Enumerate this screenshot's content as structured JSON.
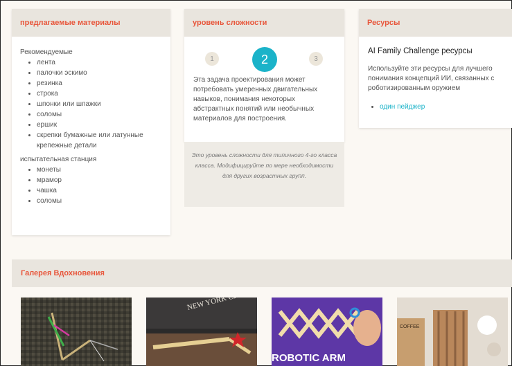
{
  "materials": {
    "title": "предлагаемые материалы",
    "recommended_label": "Рекомендуемые",
    "recommended": [
      "лента",
      "палочки эскимо",
      "резинка",
      "строка",
      "шпонки или шпажки",
      "соломы",
      "ершик",
      "скрепки бумажные или латунные крепежные детали"
    ],
    "station_label": "испытательная станция",
    "station": [
      "монеты",
      "мрамор",
      "чашка",
      "соломы"
    ]
  },
  "difficulty": {
    "title": "уровень сложности",
    "steps": [
      "1",
      "2",
      "3"
    ],
    "active_step": "2",
    "description": "Эта задача проектирования может потребовать умеренных двигательных навыков, понимания некоторых абстрактных понятий или необычных материалов для построения.",
    "note": "Это уровень сложности для типичного 4-го класса класса. Модифицируйте по мере необходимости для других возрастных групп."
  },
  "resources": {
    "title": "Ресурсы",
    "heading": "AI Family Challenge ресурсы",
    "description": "Используйте эти ресурсы для лучшего понимания концепций ИИ, связанных с роботизированным оружием",
    "links": [
      "один пейджер"
    ]
  },
  "gallery": {
    "title": "Галерея Вдохновения",
    "image3_text": "ROBOTIC ARM",
    "image2_text": "NEW YORK CITY",
    "image4_text": "COFFEE"
  },
  "colors": {
    "accent": "#e8573c",
    "link": "#1bb3c9",
    "header_bg": "#e9e5de"
  }
}
